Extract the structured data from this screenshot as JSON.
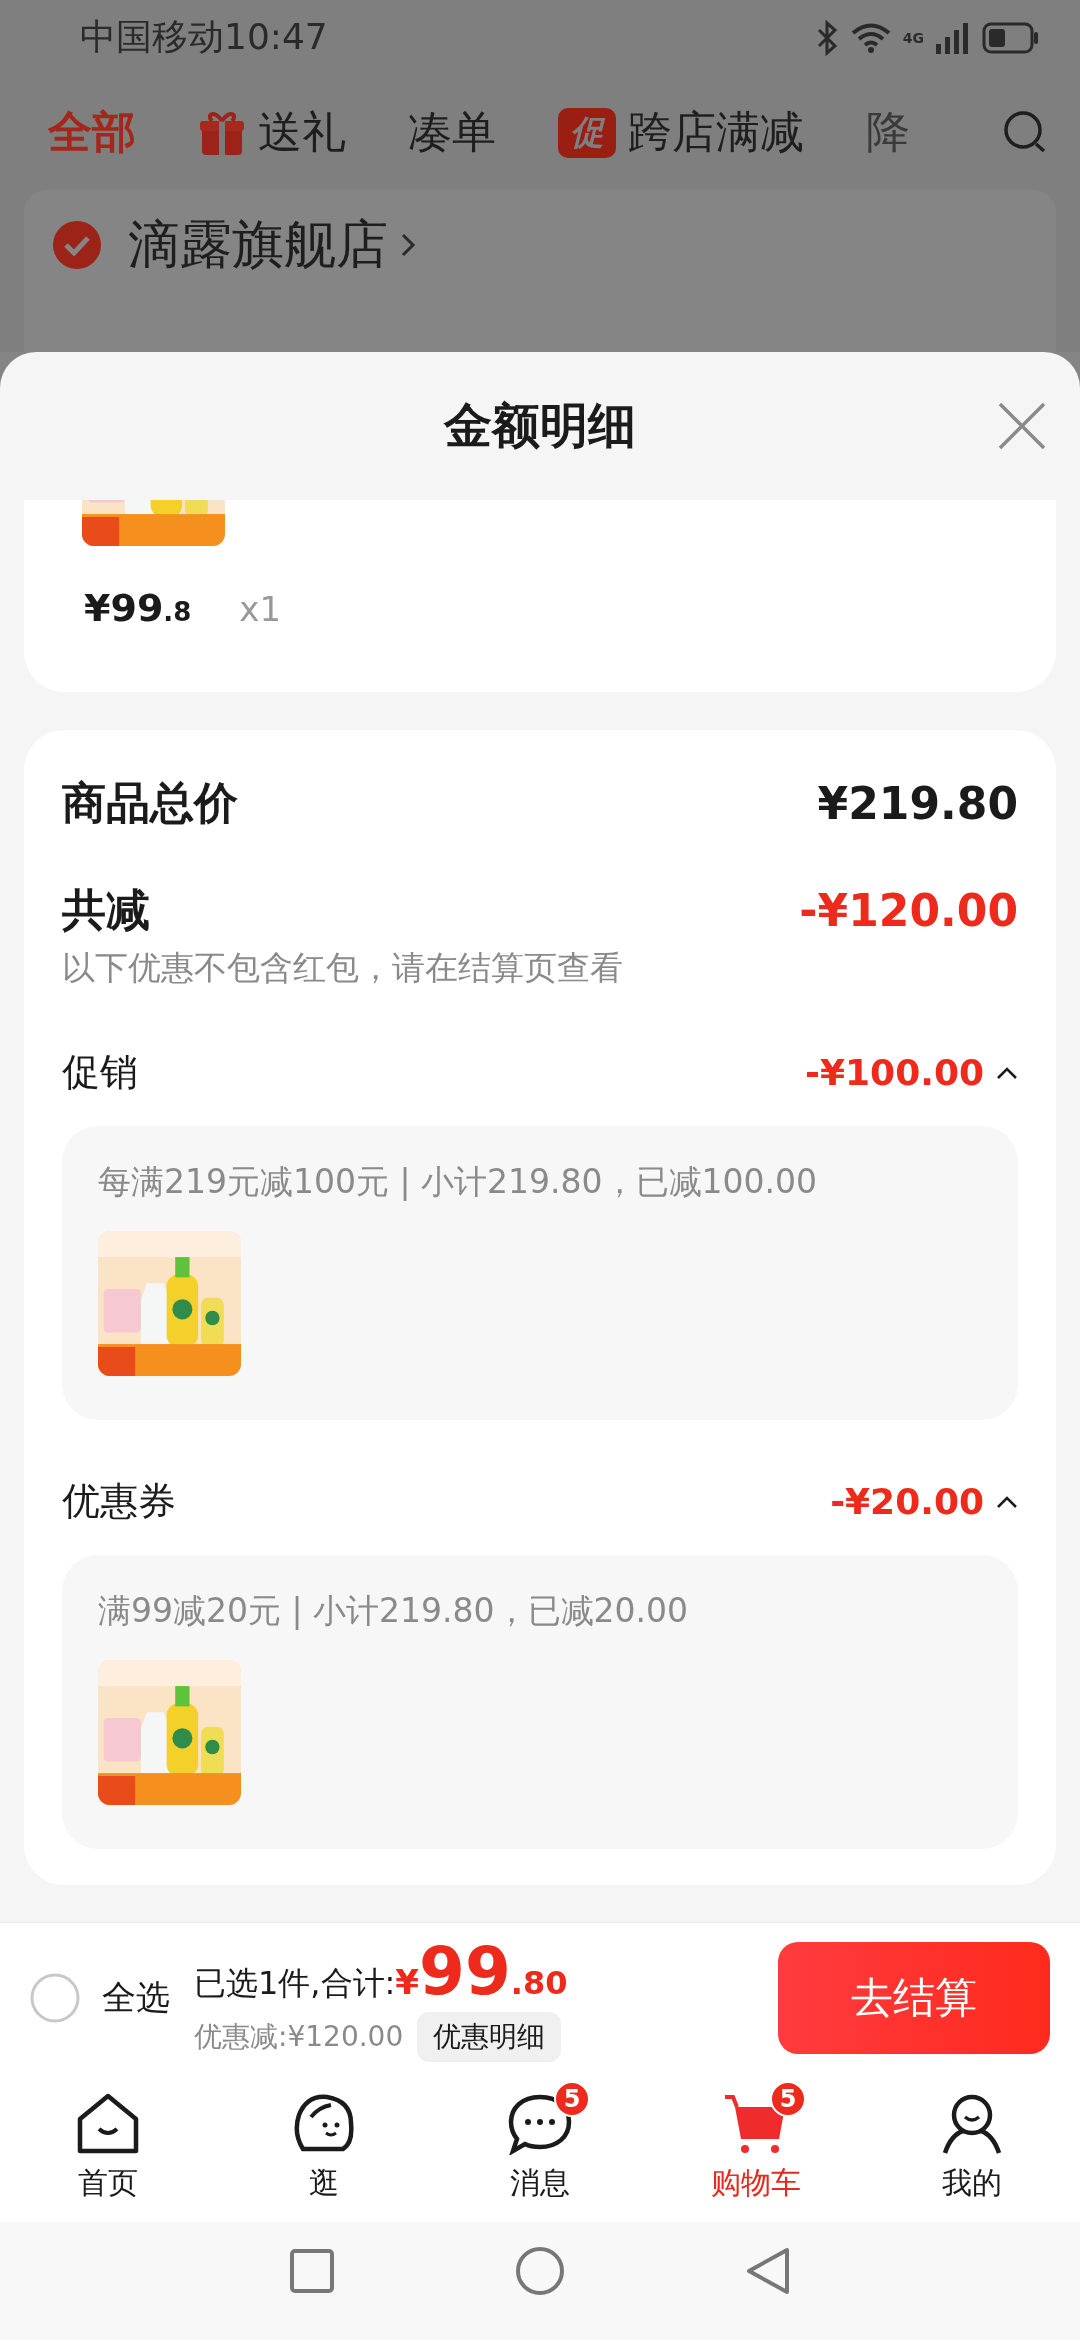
{
  "status_bar": {
    "carrier": "中国移动",
    "time": "10:47",
    "network": "4G"
  },
  "category_tabs": [
    {
      "label": "全部",
      "kind": "plain",
      "selected": true
    },
    {
      "label": "送礼",
      "kind": "gift",
      "selected": false
    },
    {
      "label": "凑单",
      "kind": "plain",
      "selected": false
    },
    {
      "label": "跨店满减",
      "kind": "promo",
      "badge": "促",
      "selected": false
    },
    {
      "label": "降",
      "kind": "plain",
      "selected": false
    }
  ],
  "store": {
    "name": "滴露旗舰店",
    "checked": true
  },
  "sheet": {
    "title": "金额明细",
    "item": {
      "price": "¥99",
      "price_decimal": ".8",
      "quantity": "x1"
    },
    "summary": {
      "total_label": "商品总价",
      "total": "¥219.80",
      "discount_label": "共减",
      "discount": "-¥120.00",
      "note": "以下优惠不包含红包，请在结算页查看"
    },
    "groups": [
      {
        "label": "促销",
        "amount": "-¥100.00",
        "expanded": true,
        "rule": "每满219元减100元 | 小计219.80，已减100.00"
      },
      {
        "label": "优惠券",
        "amount": "-¥20.00",
        "expanded": true,
        "rule": "满99减20元 | 小计219.80，已减20.00"
      }
    ]
  },
  "checkout": {
    "select_all_label": "全选",
    "select_all_checked": false,
    "selected_text": "已选1件,合计:",
    "currency": "¥",
    "total_int": "99",
    "total_dec": ".80",
    "discount_text": "优惠减:¥120.00",
    "details_button": "优惠明细",
    "checkout_button": "去结算"
  },
  "nav": [
    {
      "label": "首页",
      "kind": "home",
      "selected": false
    },
    {
      "label": "逛",
      "kind": "browse",
      "selected": false
    },
    {
      "label": "消息",
      "kind": "message",
      "badge": "5",
      "selected": false
    },
    {
      "label": "购物车",
      "kind": "cart",
      "badge": "5",
      "selected": true
    },
    {
      "label": "我的",
      "kind": "profile",
      "selected": false
    }
  ]
}
